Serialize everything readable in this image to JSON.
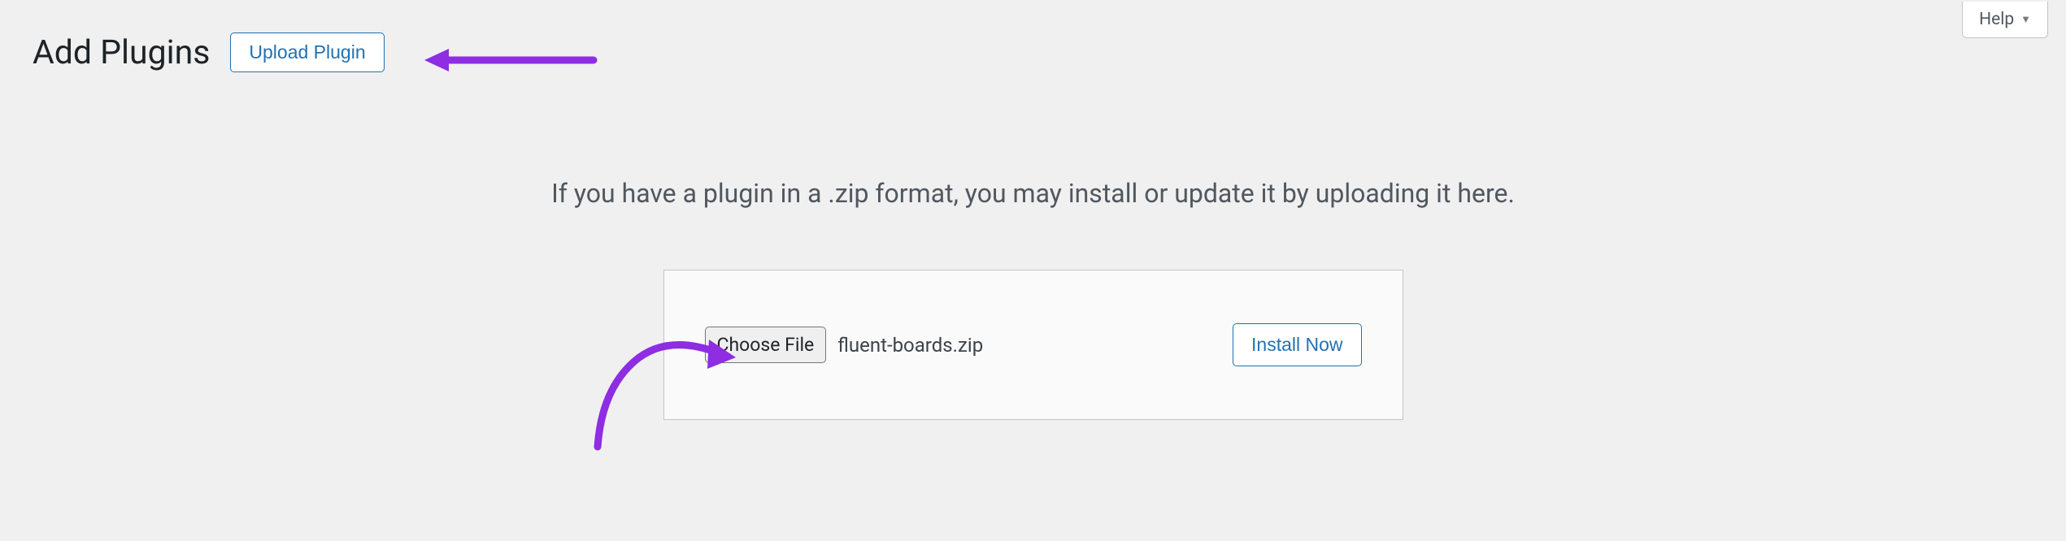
{
  "header": {
    "title": "Add Plugins",
    "upload_button_label": "Upload Plugin",
    "help_label": "Help"
  },
  "instruction_text": "If you have a plugin in a .zip format, you may install or update it by uploading it here.",
  "upload_form": {
    "choose_file_label": "Choose File",
    "selected_filename": "fluent-boards.zip",
    "install_button_label": "Install Now"
  },
  "annotation": {
    "arrow_color": "#8e2de2"
  }
}
